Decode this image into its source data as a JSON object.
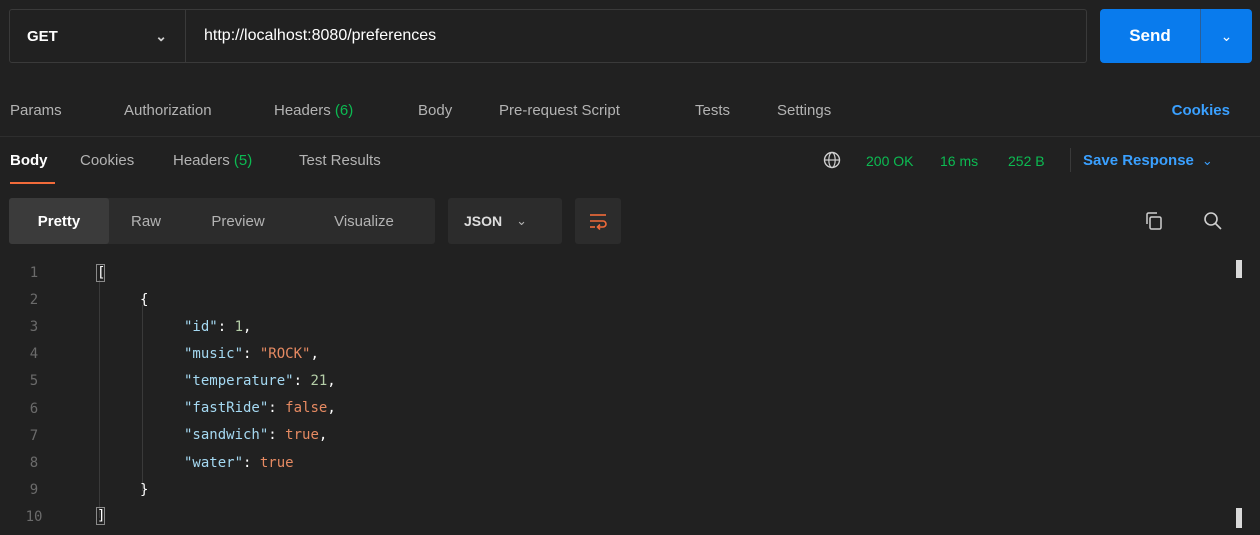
{
  "request": {
    "method": "GET",
    "url": "http://localhost:8080/preferences",
    "send_label": "Send"
  },
  "request_tabs": {
    "params": "Params",
    "authorization": "Authorization",
    "headers": "Headers",
    "headers_count": "(6)",
    "body": "Body",
    "pre_request": "Pre-request Script",
    "tests": "Tests",
    "settings": "Settings",
    "cookies": "Cookies"
  },
  "response_tabs": {
    "body": "Body",
    "cookies": "Cookies",
    "headers": "Headers",
    "headers_count": "(5)",
    "test_results": "Test Results"
  },
  "response_status": {
    "status": "200 OK",
    "time": "16 ms",
    "size": "252 B",
    "save_label": "Save Response"
  },
  "view_modes": {
    "pretty": "Pretty",
    "raw": "Raw",
    "preview": "Preview",
    "visualize": "Visualize",
    "format": "JSON"
  },
  "icons": {
    "method_chevron": "chevron-down-icon",
    "send_chevron": "chevron-down-icon",
    "globe": "globe-icon",
    "wrap": "wrap-lines-icon",
    "copy": "copy-icon",
    "search": "search-icon"
  },
  "colors": {
    "accent_blue": "#097bed",
    "link_blue": "#3aa0ff",
    "success_green": "#0cbb52",
    "active_underline": "#f26b3a"
  },
  "code": {
    "line_numbers": [
      "1",
      "2",
      "3",
      "4",
      "5",
      "6",
      "7",
      "8",
      "9",
      "10"
    ],
    "open_bracket": "[",
    "close_bracket": "]",
    "open_brace": "{",
    "close_brace": "}",
    "fields": [
      {
        "key": "\"id\"",
        "value": "1",
        "type": "num",
        "trail": ","
      },
      {
        "key": "\"music\"",
        "value": "\"ROCK\"",
        "type": "str",
        "trail": ","
      },
      {
        "key": "\"temperature\"",
        "value": "21",
        "type": "num",
        "trail": ","
      },
      {
        "key": "\"fastRide\"",
        "value": "false",
        "type": "bool",
        "trail": ","
      },
      {
        "key": "\"sandwich\"",
        "value": "true",
        "type": "bool",
        "trail": ","
      },
      {
        "key": "\"water\"",
        "value": "true",
        "type": "bool",
        "trail": ""
      }
    ]
  }
}
